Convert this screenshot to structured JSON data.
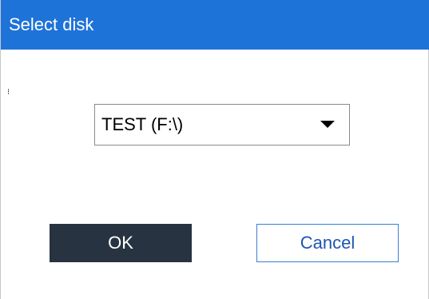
{
  "window": {
    "title": "Select disk"
  },
  "disk_select": {
    "selected_value": "TEST (F:\\)"
  },
  "buttons": {
    "ok_label": "OK",
    "cancel_label": "Cancel"
  },
  "colors": {
    "titlebar": "#1e73d9",
    "ok_button": "#273340",
    "cancel_border": "#3a7fd6",
    "cancel_text": "#1e55b4"
  }
}
